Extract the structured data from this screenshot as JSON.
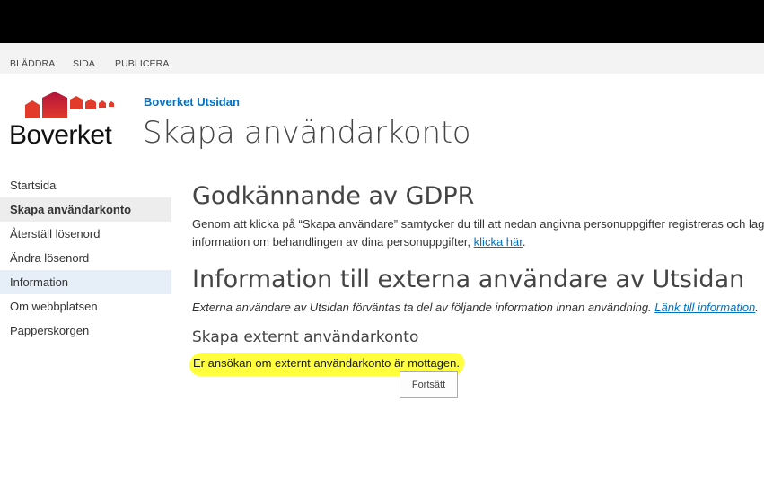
{
  "ribbon": {
    "tabs": [
      "BLÄDDRA",
      "SIDA",
      "PUBLICERA"
    ]
  },
  "header": {
    "logo_text": "Boverket",
    "site_link": "Boverket Utsidan",
    "page_title": "Skapa användarkonto"
  },
  "sidebar": {
    "items": [
      {
        "label": "Startsida"
      },
      {
        "label": "Skapa användarkonto"
      },
      {
        "label": "Återställ lösenord"
      },
      {
        "label": "Ändra lösenord"
      },
      {
        "label": "Information"
      },
      {
        "label": "Om webbplatsen"
      },
      {
        "label": "Papperskorgen"
      }
    ]
  },
  "main": {
    "gdpr_heading": "Godkännande av GDPR",
    "gdpr_text_1": "Genom att klicka på “Skapa användare” samtycker du till att nedan angivna personuppgifter registreras och lagr",
    "gdpr_text_2_pre": "information om behandlingen av dina personuppgifter, ",
    "gdpr_link": "klicka här",
    "gdpr_text_2_post": ".",
    "info_heading": "Information till externa användare av Utsidan",
    "info_text": "Externa användare av Utsidan förväntas ta del av följande information innan användning. ",
    "info_link": "Länk till information",
    "info_text_post": ".",
    "section_heading": "Skapa externt användarkonto",
    "success_message": "Er ansökan om externt användarkonto är mottagen.",
    "continue_button": "Fortsätt"
  },
  "colors": {
    "link": "#0072c6",
    "logo_red": "#d42a2a",
    "highlight": "#ffff33"
  }
}
